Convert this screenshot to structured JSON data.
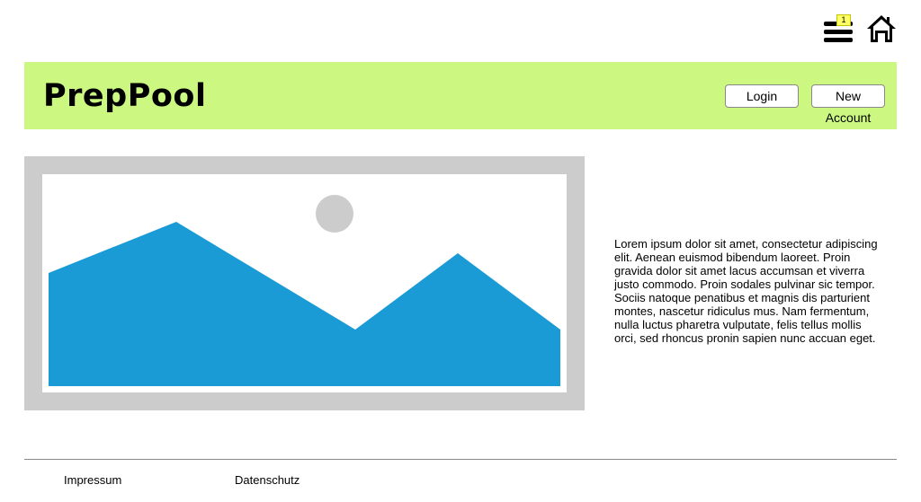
{
  "top_icons": {
    "menu_badge": "1",
    "menu_icon": "hamburger-menu-icon",
    "home_icon": "home-icon",
    "badge_color": "#ffff66"
  },
  "header": {
    "brand": "PrepPool",
    "login_label": "Login",
    "new_account_label": "New Account",
    "background_color": "#ccf882"
  },
  "main": {
    "image": {
      "type": "placeholder image",
      "frame_color": "#cccccc",
      "mountain_color": "#1a9bd6",
      "sun_color": "#cccccc"
    },
    "paragraph": "Lorem ipsum dolor sit amet, consectetur adipiscing elit. Aenean euismod bibendum laoreet. Proin gravida dolor sit amet lacus accumsan et viverra justo commodo. Proin sodales pulvinar sic tempor. Sociis natoque penatibus et magnis dis parturient montes, nascetur ridiculus mus. Nam fermentum, nulla luctus pharetra vulputate, felis tellus mollis orci, sed rhoncus pronin sapien nunc accuan eget."
  },
  "footer": {
    "links": [
      "Impressum",
      "Datenschutz"
    ]
  }
}
